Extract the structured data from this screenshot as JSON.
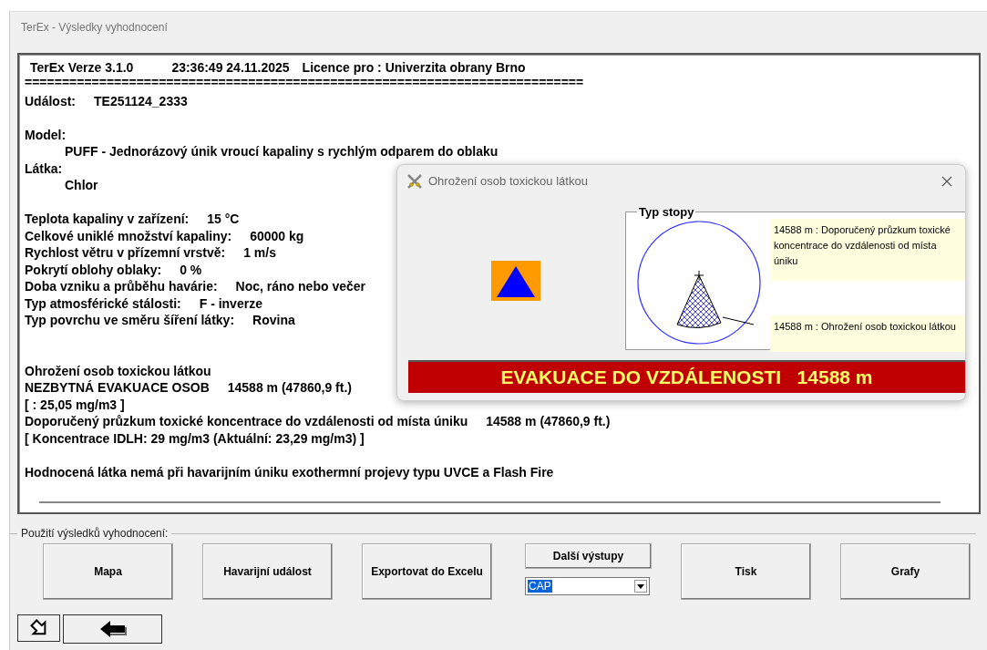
{
  "window": {
    "title": "TerEx - Výsledky vyhodnocení"
  },
  "report": {
    "header": {
      "product": "TerEx  Verze 3.1.0",
      "timestamp": "23:36:49  24.11.2025",
      "license": "Licence pro : Univerzita obrany Brno"
    },
    "lines": [
      {
        "kind": "rule",
        "text": "==========================================================================="
      },
      {
        "kind": "pair",
        "label": "Událost:",
        "value": "TE251124_2333"
      },
      {
        "kind": "blank"
      },
      {
        "kind": "text",
        "text": "Model:"
      },
      {
        "kind": "indent",
        "text": "PUFF - Jednorázový únik vroucí kapaliny s rychlým odparem do oblaku"
      },
      {
        "kind": "text",
        "text": "Látka:"
      },
      {
        "kind": "indent",
        "text": "Chlor"
      },
      {
        "kind": "blank"
      },
      {
        "kind": "pair",
        "label": "Teplota kapaliny v zařízení:",
        "value": "15 °C"
      },
      {
        "kind": "pair",
        "label": "Celkové uniklé množství kapaliny:",
        "value": "60000 kg"
      },
      {
        "kind": "pair",
        "label": "Rychlost větru v přízemní vrstvě:",
        "value": "1 m/s"
      },
      {
        "kind": "pair",
        "label": "Pokrytí oblohy oblaky:",
        "value": "0 %"
      },
      {
        "kind": "pair",
        "label": "Doba vzniku a průběhu havárie:",
        "value": "Noc, ráno nebo večer"
      },
      {
        "kind": "pair",
        "label": "Typ atmosférické stálosti:",
        "value": "F - inverze"
      },
      {
        "kind": "pair",
        "label": "Typ povrchu ve směru šíření látky:",
        "value": "Rovina"
      },
      {
        "kind": "blank"
      },
      {
        "kind": "blank"
      },
      {
        "kind": "text",
        "text": "Ohrožení osob toxickou látkou"
      },
      {
        "kind": "pair",
        "label": "NEZBYTNÁ EVAKUACE OSOB",
        "value": "14588 m (47860,9 ft.)"
      },
      {
        "kind": "text",
        "text": "[ : 25,05 mg/m3 ]"
      },
      {
        "kind": "pair",
        "label": "Doporučený průzkum toxické koncentrace do vzdálenosti od místa úniku",
        "value": "14588 m (47860,9 ft.)"
      },
      {
        "kind": "text",
        "text": "[ Koncentrace IDLH: 29 mg/m3 (Aktuální: 23,29 mg/m3) ]"
      },
      {
        "kind": "blank"
      },
      {
        "kind": "text",
        "text": "Hodnocená látka nemá při havarijním úniku exothermní projevy typu UVCE a Flash Fire"
      }
    ]
  },
  "dialog": {
    "title": "Ohrožení osob toxickou látkou",
    "group_title": "Typ stopy",
    "notes": [
      "14588 m : Doporučený průzkum toxické koncentrace do vzdálenosti od místa úniku",
      "14588 m : Ohrožení osob toxickou látkou"
    ],
    "banner": "EVAKUACE DO VZDÁLENOSTI   14588 m"
  },
  "actions": {
    "group_title": "Použití výsledků vyhodnocení:",
    "buttons": [
      {
        "kind": "button",
        "label": "Mapa"
      },
      {
        "kind": "button",
        "label": "Havarijní událost"
      },
      {
        "kind": "button",
        "label": "Exportovat do Excelu"
      },
      {
        "kind": "combo",
        "label": "Další výstupy",
        "value": "CAP"
      },
      {
        "kind": "button",
        "label": "Tisk"
      },
      {
        "kind": "button",
        "label": "Grafy"
      }
    ]
  }
}
